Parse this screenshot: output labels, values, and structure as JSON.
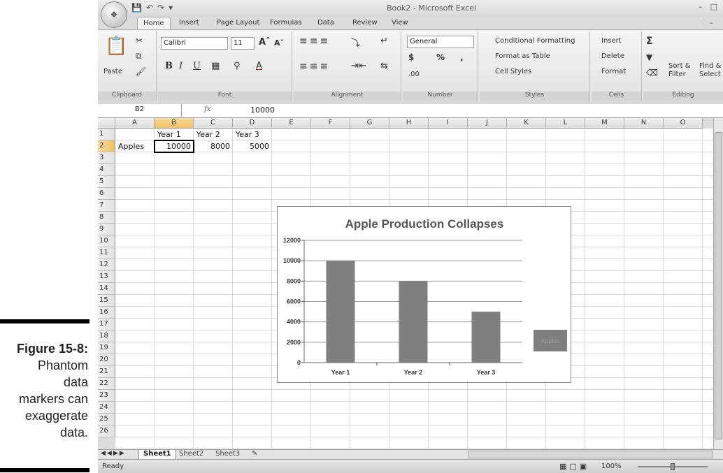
{
  "caption": {
    "figure": "Figure 15-8:",
    "lines": [
      "Phantom",
      "data",
      "markers can",
      "exaggerate",
      "data."
    ]
  },
  "window": {
    "title": "Book2 - Microsoft Excel"
  },
  "ribbon": {
    "tabs": [
      "Home",
      "Insert",
      "Page Layout",
      "Formulas",
      "Data",
      "Review",
      "View"
    ],
    "active_tab": "Home",
    "clipboard": {
      "paste": "Paste",
      "label": "Clipboard"
    },
    "font": {
      "name": "Calibri",
      "size": "11",
      "bold": "B",
      "italic": "I",
      "underline": "U",
      "label": "Font"
    },
    "alignment": {
      "label": "Alignment"
    },
    "number": {
      "format": "General",
      "currency": "$",
      "percent": "%",
      "comma": ",",
      "inc_dec": ".00",
      "label": "Number"
    },
    "styles": {
      "conditional": "Conditional Formatting",
      "format_table": "Format as Table",
      "cell_styles": "Cell Styles",
      "label": "Styles"
    },
    "cells": {
      "insert": "Insert",
      "delete": "Delete",
      "format": "Format",
      "label": "Cells"
    },
    "editing": {
      "sort": "Sort &",
      "sort2": "Filter",
      "find": "Find &",
      "find2": "Select",
      "label": "Editing"
    }
  },
  "formula_bar": {
    "name_box": "B2",
    "fx": "fx",
    "value": "10000"
  },
  "columns": [
    "A",
    "B",
    "C",
    "D",
    "E",
    "F",
    "G",
    "H",
    "I",
    "J",
    "K",
    "L",
    "M",
    "N",
    "O"
  ],
  "rows": [
    "1",
    "2",
    "3",
    "4",
    "5",
    "6",
    "7",
    "8",
    "9",
    "10",
    "11",
    "12",
    "13",
    "14",
    "15",
    "16",
    "17",
    "18",
    "19",
    "20",
    "21",
    "22",
    "23",
    "24",
    "25",
    "26"
  ],
  "sheet": {
    "header_row": [
      "",
      "Year 1",
      "Year 2",
      "Year 3"
    ],
    "data_row": [
      "Apples",
      "10000",
      "8000",
      "5000"
    ]
  },
  "chart_data": {
    "type": "bar",
    "title": "Apple Production Collapses",
    "categories": [
      "Year 1",
      "Year 2",
      "Year 3"
    ],
    "series": [
      {
        "name": "Apples",
        "values": [
          10000,
          8000,
          5000
        ]
      }
    ],
    "yticks": [
      "0",
      "2000",
      "4000",
      "6000",
      "8000",
      "10000",
      "12000"
    ],
    "ylim": [
      0,
      12000
    ],
    "legend": "right",
    "grid": true,
    "colors": {
      "bar": "#7f7f7f",
      "grid": "#9a9a9a"
    }
  },
  "sheet_tabs": [
    "Sheet1",
    "Sheet2",
    "Sheet3"
  ],
  "active_sheet": "Sheet1",
  "status": {
    "text": "Ready",
    "zoom": "100%"
  }
}
